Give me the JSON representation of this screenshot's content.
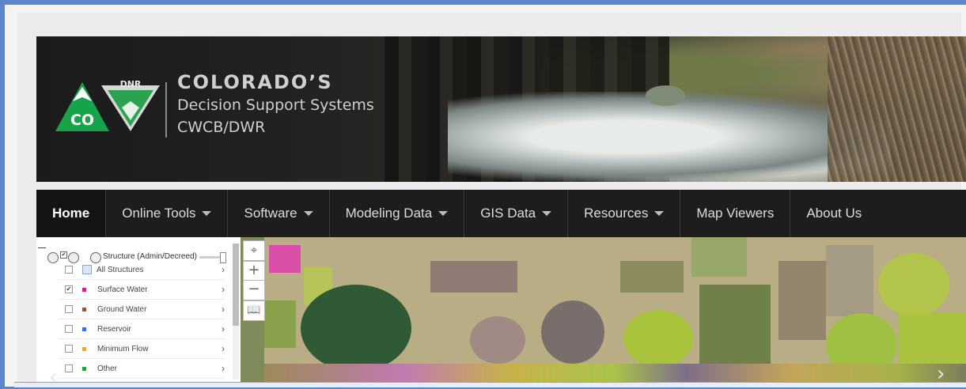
{
  "header": {
    "logo_text": "CO",
    "logo_badge": "DNR",
    "brand_title": "COLORADO’S",
    "brand_subtitle": "Decision Support Systems",
    "brand_org": "CWCB/DWR"
  },
  "nav": {
    "items": [
      {
        "label": "Home",
        "dropdown": false,
        "active": true
      },
      {
        "label": "Online Tools",
        "dropdown": true
      },
      {
        "label": "Software",
        "dropdown": true
      },
      {
        "label": "Modeling Data",
        "dropdown": true
      },
      {
        "label": "GIS Data",
        "dropdown": true
      },
      {
        "label": "Resources",
        "dropdown": true
      },
      {
        "label": "Map Viewers",
        "dropdown": false
      },
      {
        "label": "About Us",
        "dropdown": false
      }
    ]
  },
  "layers": {
    "header_label": "Structure (Admin/Decreed)",
    "rows": [
      {
        "label": "All Structures",
        "checked": false,
        "color": "#8fa8c8",
        "icon": "table-icon"
      },
      {
        "label": "Surface Water",
        "checked": true,
        "color": "#d02090"
      },
      {
        "label": "Ground Water",
        "checked": false,
        "color": "#a0522d"
      },
      {
        "label": "Reservoir",
        "checked": false,
        "color": "#3a6fd8"
      },
      {
        "label": "Minimum Flow",
        "checked": false,
        "color": "#f5a623"
      },
      {
        "label": "Other",
        "checked": false,
        "color": "#2e9e3e"
      }
    ]
  },
  "map": {
    "controls": [
      "locate",
      "+",
      "−",
      "book"
    ]
  }
}
